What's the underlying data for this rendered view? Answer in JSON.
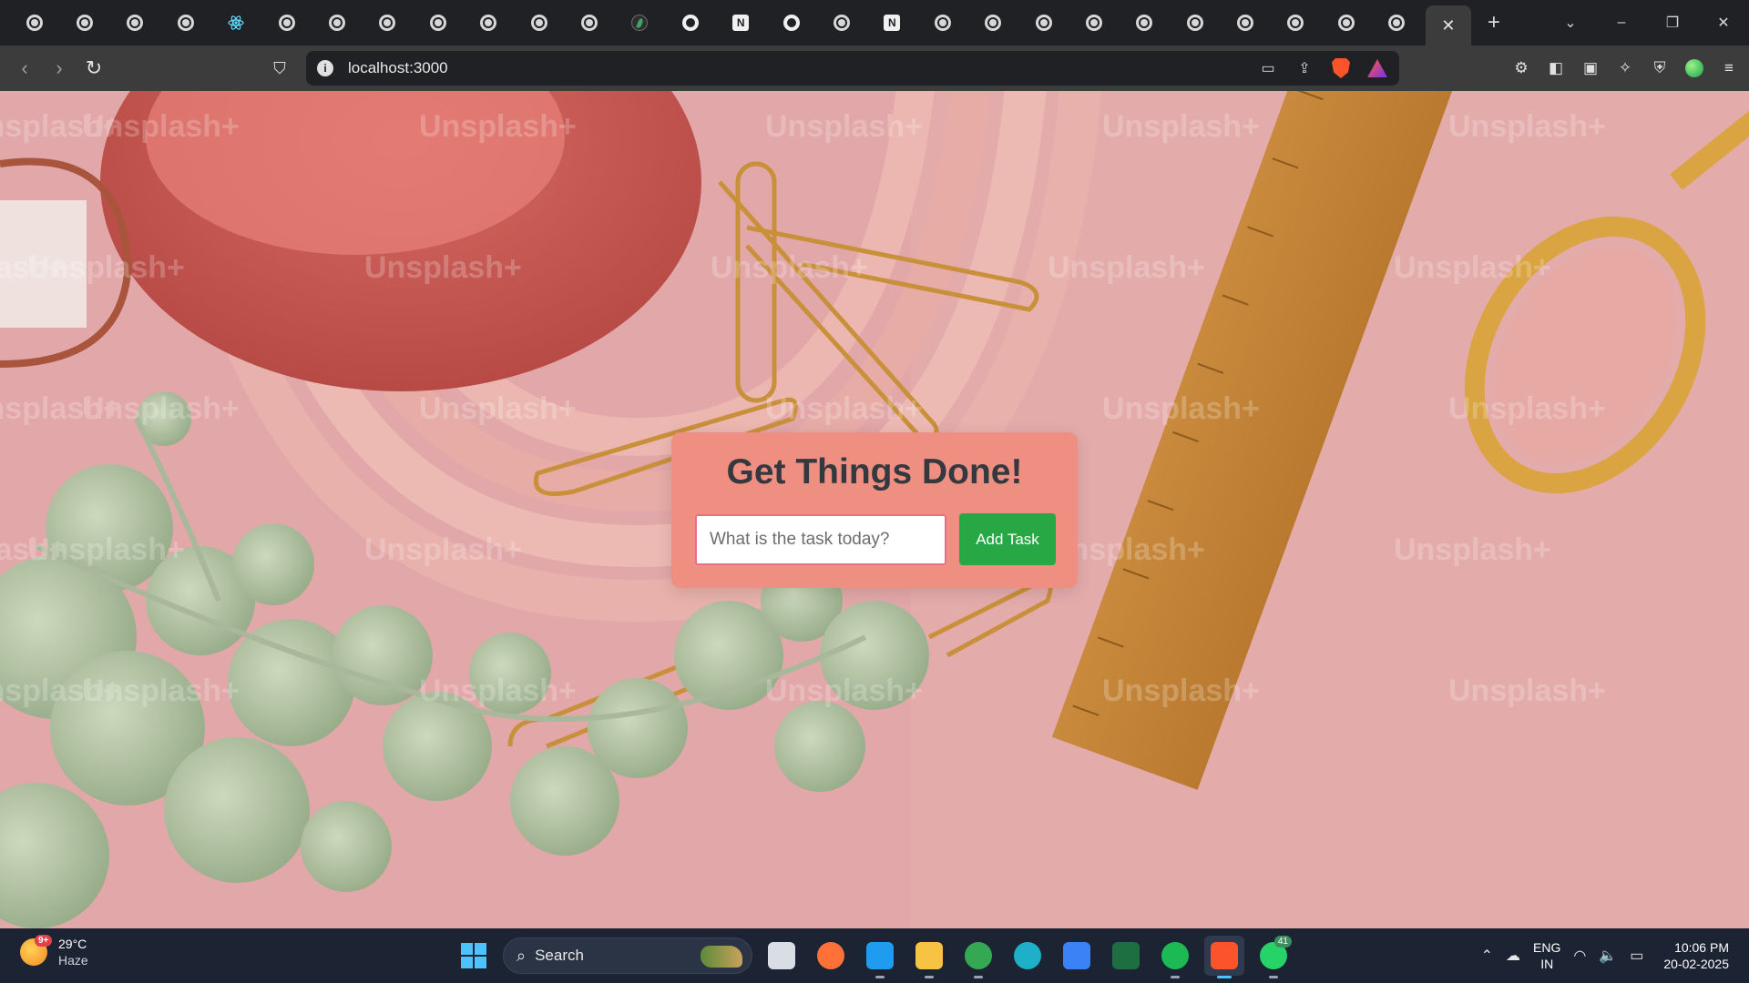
{
  "browser": {
    "tabs": [
      {
        "icon": "globe-icon"
      },
      {
        "icon": "globe-icon"
      },
      {
        "icon": "globe-icon"
      },
      {
        "icon": "globe-icon"
      },
      {
        "icon": "react-icon"
      },
      {
        "icon": "globe-icon"
      },
      {
        "icon": "globe-icon"
      },
      {
        "icon": "globe-icon"
      },
      {
        "icon": "globe-icon"
      },
      {
        "icon": "globe-icon"
      },
      {
        "icon": "globe-icon"
      },
      {
        "icon": "globe-icon"
      },
      {
        "icon": "leaf-icon"
      },
      {
        "icon": "github-icon"
      },
      {
        "icon": "notion-icon"
      },
      {
        "icon": "github-icon"
      },
      {
        "icon": "globe-icon"
      },
      {
        "icon": "notion-icon"
      },
      {
        "icon": "globe-icon"
      },
      {
        "icon": "globe-icon"
      },
      {
        "icon": "globe-icon"
      },
      {
        "icon": "globe-icon"
      },
      {
        "icon": "globe-icon"
      },
      {
        "icon": "globe-icon"
      },
      {
        "icon": "globe-icon"
      },
      {
        "icon": "globe-icon"
      },
      {
        "icon": "globe-icon"
      },
      {
        "icon": "globe-icon"
      }
    ],
    "notion_glyph": "N",
    "active_tab_close": "✕",
    "new_tab": "+",
    "url": "localhost:3000",
    "info_glyph": "i"
  },
  "app": {
    "title": "Get Things Done!",
    "input_placeholder": "What is the task today?",
    "add_button": "Add Task",
    "colors": {
      "card": "#ef8f82",
      "title_text": "#33393f",
      "button": "#28a745",
      "input_border": "#ea6f86"
    }
  },
  "background": {
    "watermark": "Unsplash+"
  },
  "taskbar": {
    "weather": {
      "temp": "29°C",
      "condition": "Haze",
      "badge": "9+"
    },
    "search_label": "Search",
    "apps": [
      {
        "name": "task-view",
        "color": "#d9dde4"
      },
      {
        "name": "firefox",
        "color": "#ff7139"
      },
      {
        "name": "vscode",
        "color": "#1f9cf0"
      },
      {
        "name": "file-explorer",
        "color": "#f6c343"
      },
      {
        "name": "chrome",
        "color": "#34a853"
      },
      {
        "name": "edge",
        "color": "#1fb0c9"
      },
      {
        "name": "microsoft-store",
        "color": "#3b82f6"
      },
      {
        "name": "excel",
        "color": "#1d6f42"
      },
      {
        "name": "spotify",
        "color": "#1db954"
      },
      {
        "name": "brave",
        "color": "#fb542b"
      },
      {
        "name": "whatsapp",
        "color": "#25d366"
      }
    ],
    "whatsapp_count": "41",
    "tray": {
      "lang_top": "ENG",
      "lang_bottom": "IN",
      "time": "10:06 PM",
      "date": "20-02-2025"
    }
  }
}
